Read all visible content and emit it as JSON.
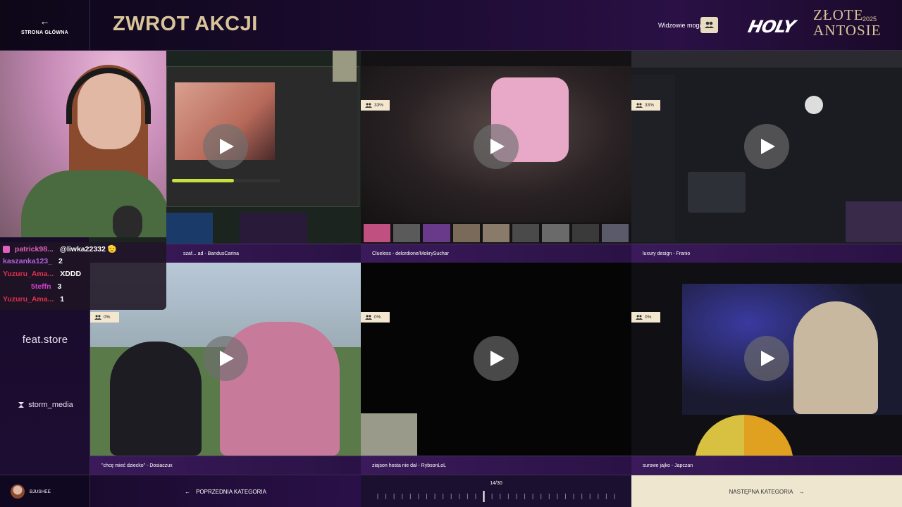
{
  "header": {
    "home_label": "STRONA GŁÓWNA",
    "title": "ZWROT AKCJI",
    "viewers_label": "Widzowie mogą",
    "logo_holy": "HOLY",
    "logo_zlote": "ZŁOTE",
    "logo_antosie": "ANTOSIE",
    "logo_year": "2025"
  },
  "sidebar": {
    "sponsors": [
      "feat.store",
      "storm_media"
    ]
  },
  "chat": [
    {
      "user": "patrick98...",
      "msg": "@liwka22332 🫡",
      "color": "#e060c0"
    },
    {
      "user": "kaszanka123_",
      "msg": "2",
      "color": "#b060e0"
    },
    {
      "user": "Yuzuru_Ama...",
      "msg": "XDDD",
      "color": "#e03050"
    },
    {
      "user": "5teffn",
      "msg": "3",
      "color": "#d040d0"
    },
    {
      "user": "Yuzuru_Ama...",
      "msg": "1",
      "color": "#e03050"
    }
  ],
  "tiles": [
    {
      "caption": "szaf... ad - BandusCarina",
      "percent": ""
    },
    {
      "caption": "Clueless - delordione/MokrySuchar",
      "percent": "33%"
    },
    {
      "caption": "luxury design - Franio",
      "percent": "33%"
    },
    {
      "caption": "\"chcę mieć dziecko\" - Dosiaczux",
      "percent": "0%"
    },
    {
      "caption": "ziajson hosta nie dał - RybsonLoL",
      "percent": "0%"
    },
    {
      "caption": "surowe jajko - Japczan",
      "percent": "0%"
    }
  ],
  "footer": {
    "username": "BJUSHEE",
    "prev_label": "POPRZEDNIA KATEGORIA",
    "progress": "14/30",
    "progress_current": 14,
    "progress_total": 30,
    "next_label": "NASTĘPNA KATEGORIA"
  },
  "colors": {
    "accent_gold": "#d9c49a",
    "purple_bar": "#3a1a5a",
    "cream": "#f3e8cf"
  }
}
